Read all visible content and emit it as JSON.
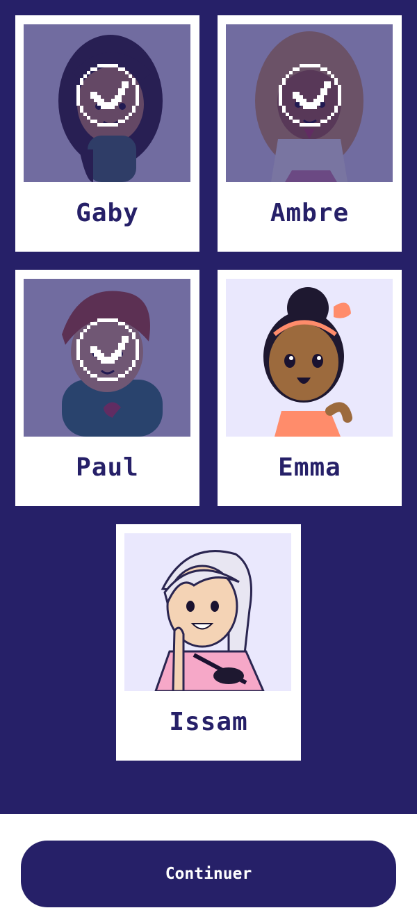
{
  "characters": [
    {
      "name": "Gaby",
      "selected": true,
      "skin": "#c98a63",
      "hair": "#2a1d33",
      "shirt": "#3d6d67"
    },
    {
      "name": "Ambre",
      "selected": true,
      "skin": "#a8603f",
      "hair": "#d9a468",
      "shirt": "#ffffff"
    },
    {
      "name": "Paul",
      "selected": true,
      "skin": "#e7b08a",
      "hair": "#b24a34",
      "shirt": "#2f7c78"
    },
    {
      "name": "Emma",
      "selected": false,
      "skin": "#9c6a3d",
      "hair": "#1e1830",
      "shirt": "#ff8c6b"
    },
    {
      "name": "Issam",
      "selected": false,
      "skin": "#f4d3b5",
      "hair": "#e8e6f2",
      "shirt": "#f6a8c8"
    }
  ],
  "footer": {
    "continue_label": "Continuer"
  },
  "colors": {
    "navy": "#262068",
    "card_bg": "#ffffff",
    "photo_bg": "#eae8fd"
  }
}
